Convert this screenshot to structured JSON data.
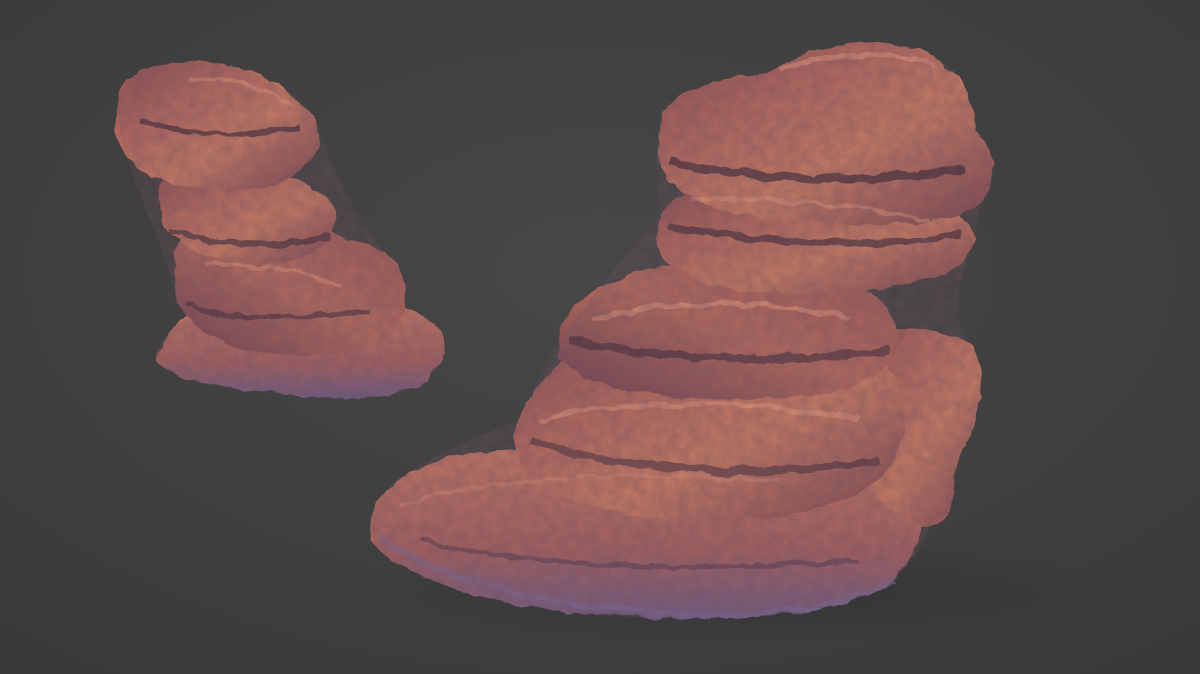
{
  "scene": {
    "background_color": "#404040",
    "rock_base_color": "#b86a5c",
    "rock_highlight_color": "#e08a6c",
    "rock_shadow_color": "#3a2a35",
    "rock_rim_color": "#7a5f8c",
    "objects": [
      "small-rock-sculpture",
      "large-rock-sculpture"
    ]
  }
}
